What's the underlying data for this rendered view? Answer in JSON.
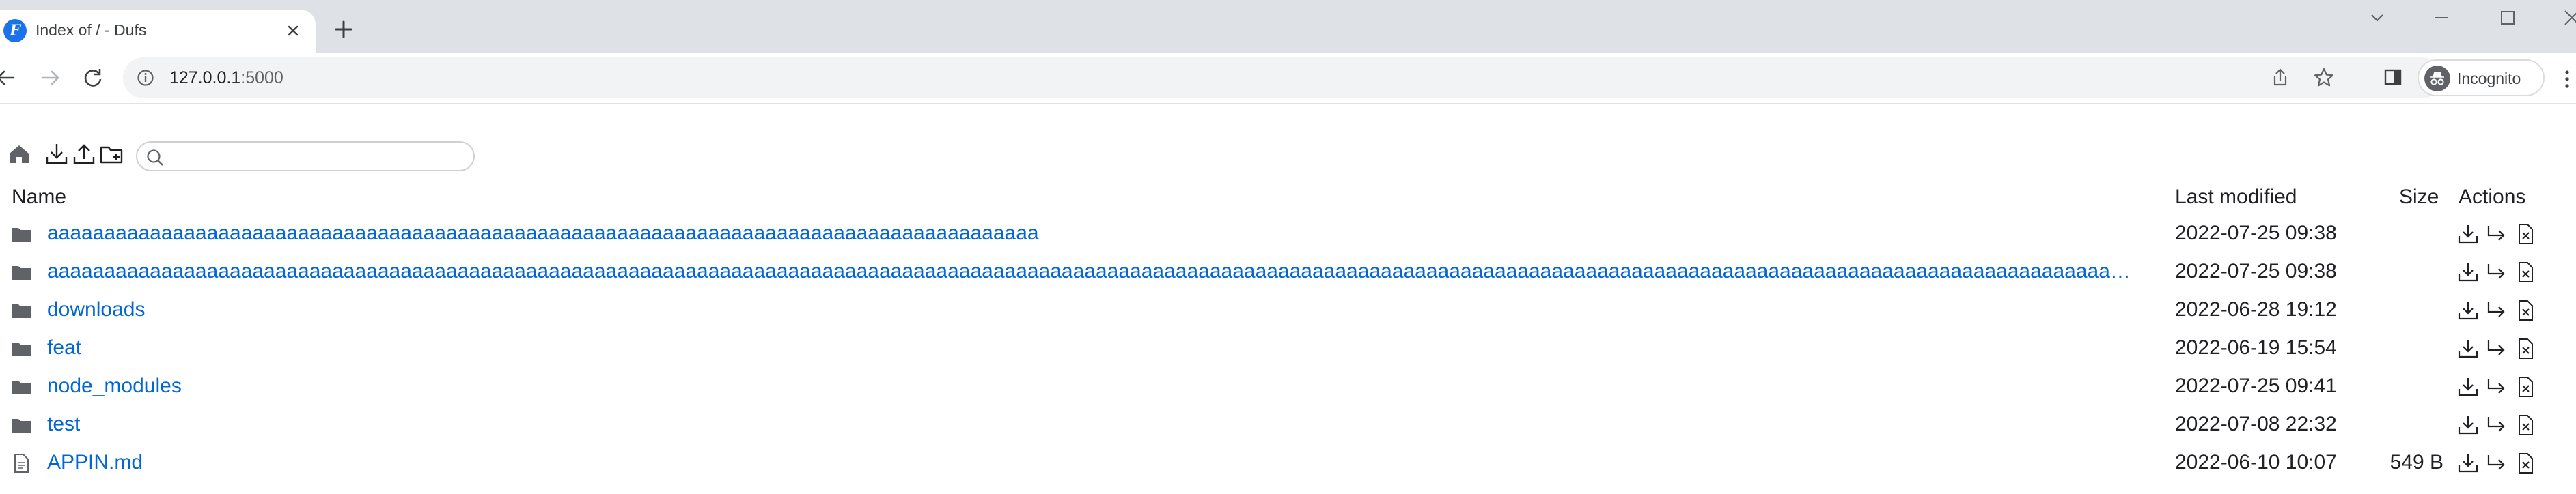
{
  "browser": {
    "tab_title": "Index of / - Dufs",
    "favicon_letter": "F",
    "url_host": "127.0.0.1",
    "url_port": ":5000",
    "profile_label": "Incognito"
  },
  "page": {
    "search_placeholder": "",
    "columns": {
      "name": "Name",
      "last_modified": "Last modified",
      "size": "Size",
      "actions": "Actions"
    },
    "entries": [
      {
        "type": "dir",
        "name": "aaaaaaaaaaaaaaaaaaaaaaaaaaaaaaaaaaaaaaaaaaaaaaaaaaaaaaaaaaaaaaaaaaaaaaaaaaaaaaaaaaaaaaa",
        "mtime": "2022-07-25 09:38",
        "size": ""
      },
      {
        "type": "dir",
        "name": "aaaaaaaaaaaaaaaaaaaaaaaaaaaaaaaaaaaaaaaaaaaaaaaaaaaaaaaaaaaaaaaaaaaaaaaaaaaaaaaaaaaaaaaaaaaaaaaaaaaaaaaaaaaaaaaaaaaaaaaaaaaaaaaaaaaaaaaaaaaaaaaaaaaaaaaaaaaaaaaaaaaaaaaaaaaaaaaaaaaaa…",
        "mtime": "2022-07-25 09:38",
        "size": ""
      },
      {
        "type": "dir",
        "name": "downloads",
        "mtime": "2022-06-28 19:12",
        "size": ""
      },
      {
        "type": "dir",
        "name": "feat",
        "mtime": "2022-06-19 15:54",
        "size": ""
      },
      {
        "type": "dir",
        "name": "node_modules",
        "mtime": "2022-07-25 09:41",
        "size": ""
      },
      {
        "type": "dir",
        "name": "test",
        "mtime": "2022-07-08 22:32",
        "size": ""
      },
      {
        "type": "file",
        "name": "APPIN.md",
        "mtime": "2022-06-10 10:07",
        "size": "549 B"
      }
    ]
  },
  "icons": {
    "folder": "folder-icon",
    "file": "file-icon",
    "download": "download-icon",
    "move": "move-icon",
    "delete": "delete-icon"
  },
  "colors": {
    "link": "#0366d6",
    "folder": "#5f6368",
    "tabbar": "#dee1e6"
  }
}
